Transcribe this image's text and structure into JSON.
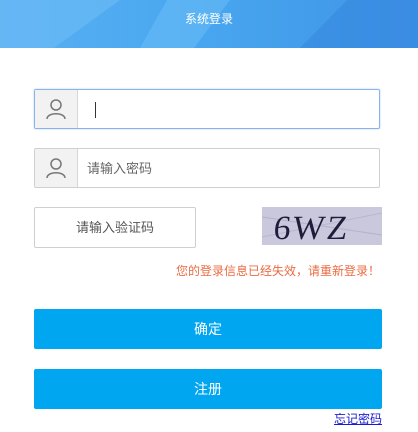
{
  "header": {
    "title": "系统登录"
  },
  "form": {
    "username": {
      "value": "",
      "placeholder": ""
    },
    "password": {
      "placeholder": "请输入密码"
    },
    "captcha": {
      "placeholder": "请输入验证码",
      "code": "6WZ"
    },
    "error_message": "您的登录信息已经失效，请重新登录！"
  },
  "buttons": {
    "confirm": "确定",
    "register": "注册",
    "forgot": "忘记密码"
  },
  "colors": {
    "primary_button": "#00a7f0",
    "error_text": "#ea6b43",
    "link": "#1a1ad0"
  }
}
